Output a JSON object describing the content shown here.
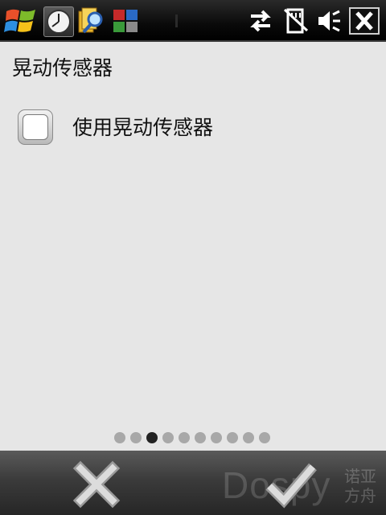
{
  "title": "晃动传感器",
  "option": {
    "label": "使用晃动传感器",
    "checked": false
  },
  "pager": {
    "total": 10,
    "current_index": 2
  },
  "watermark": {
    "brand": "Dospy",
    "brand_cn_line1": "诺亚",
    "brand_cn_line2": "方舟"
  },
  "icons": {
    "start": "windows-start-icon",
    "clock": "clock-icon",
    "search": "search-icon",
    "tiles": "tiles-icon",
    "sync": "sync-arrows-icon",
    "sdcard": "sd-card-icon",
    "volume": "volume-icon",
    "close": "close-icon",
    "cancel": "cancel-x-icon",
    "ok": "ok-check-icon"
  },
  "colors": {
    "background": "#e6e6e6",
    "statusbar": "#000000",
    "softkeys": "#3b3b3b"
  }
}
